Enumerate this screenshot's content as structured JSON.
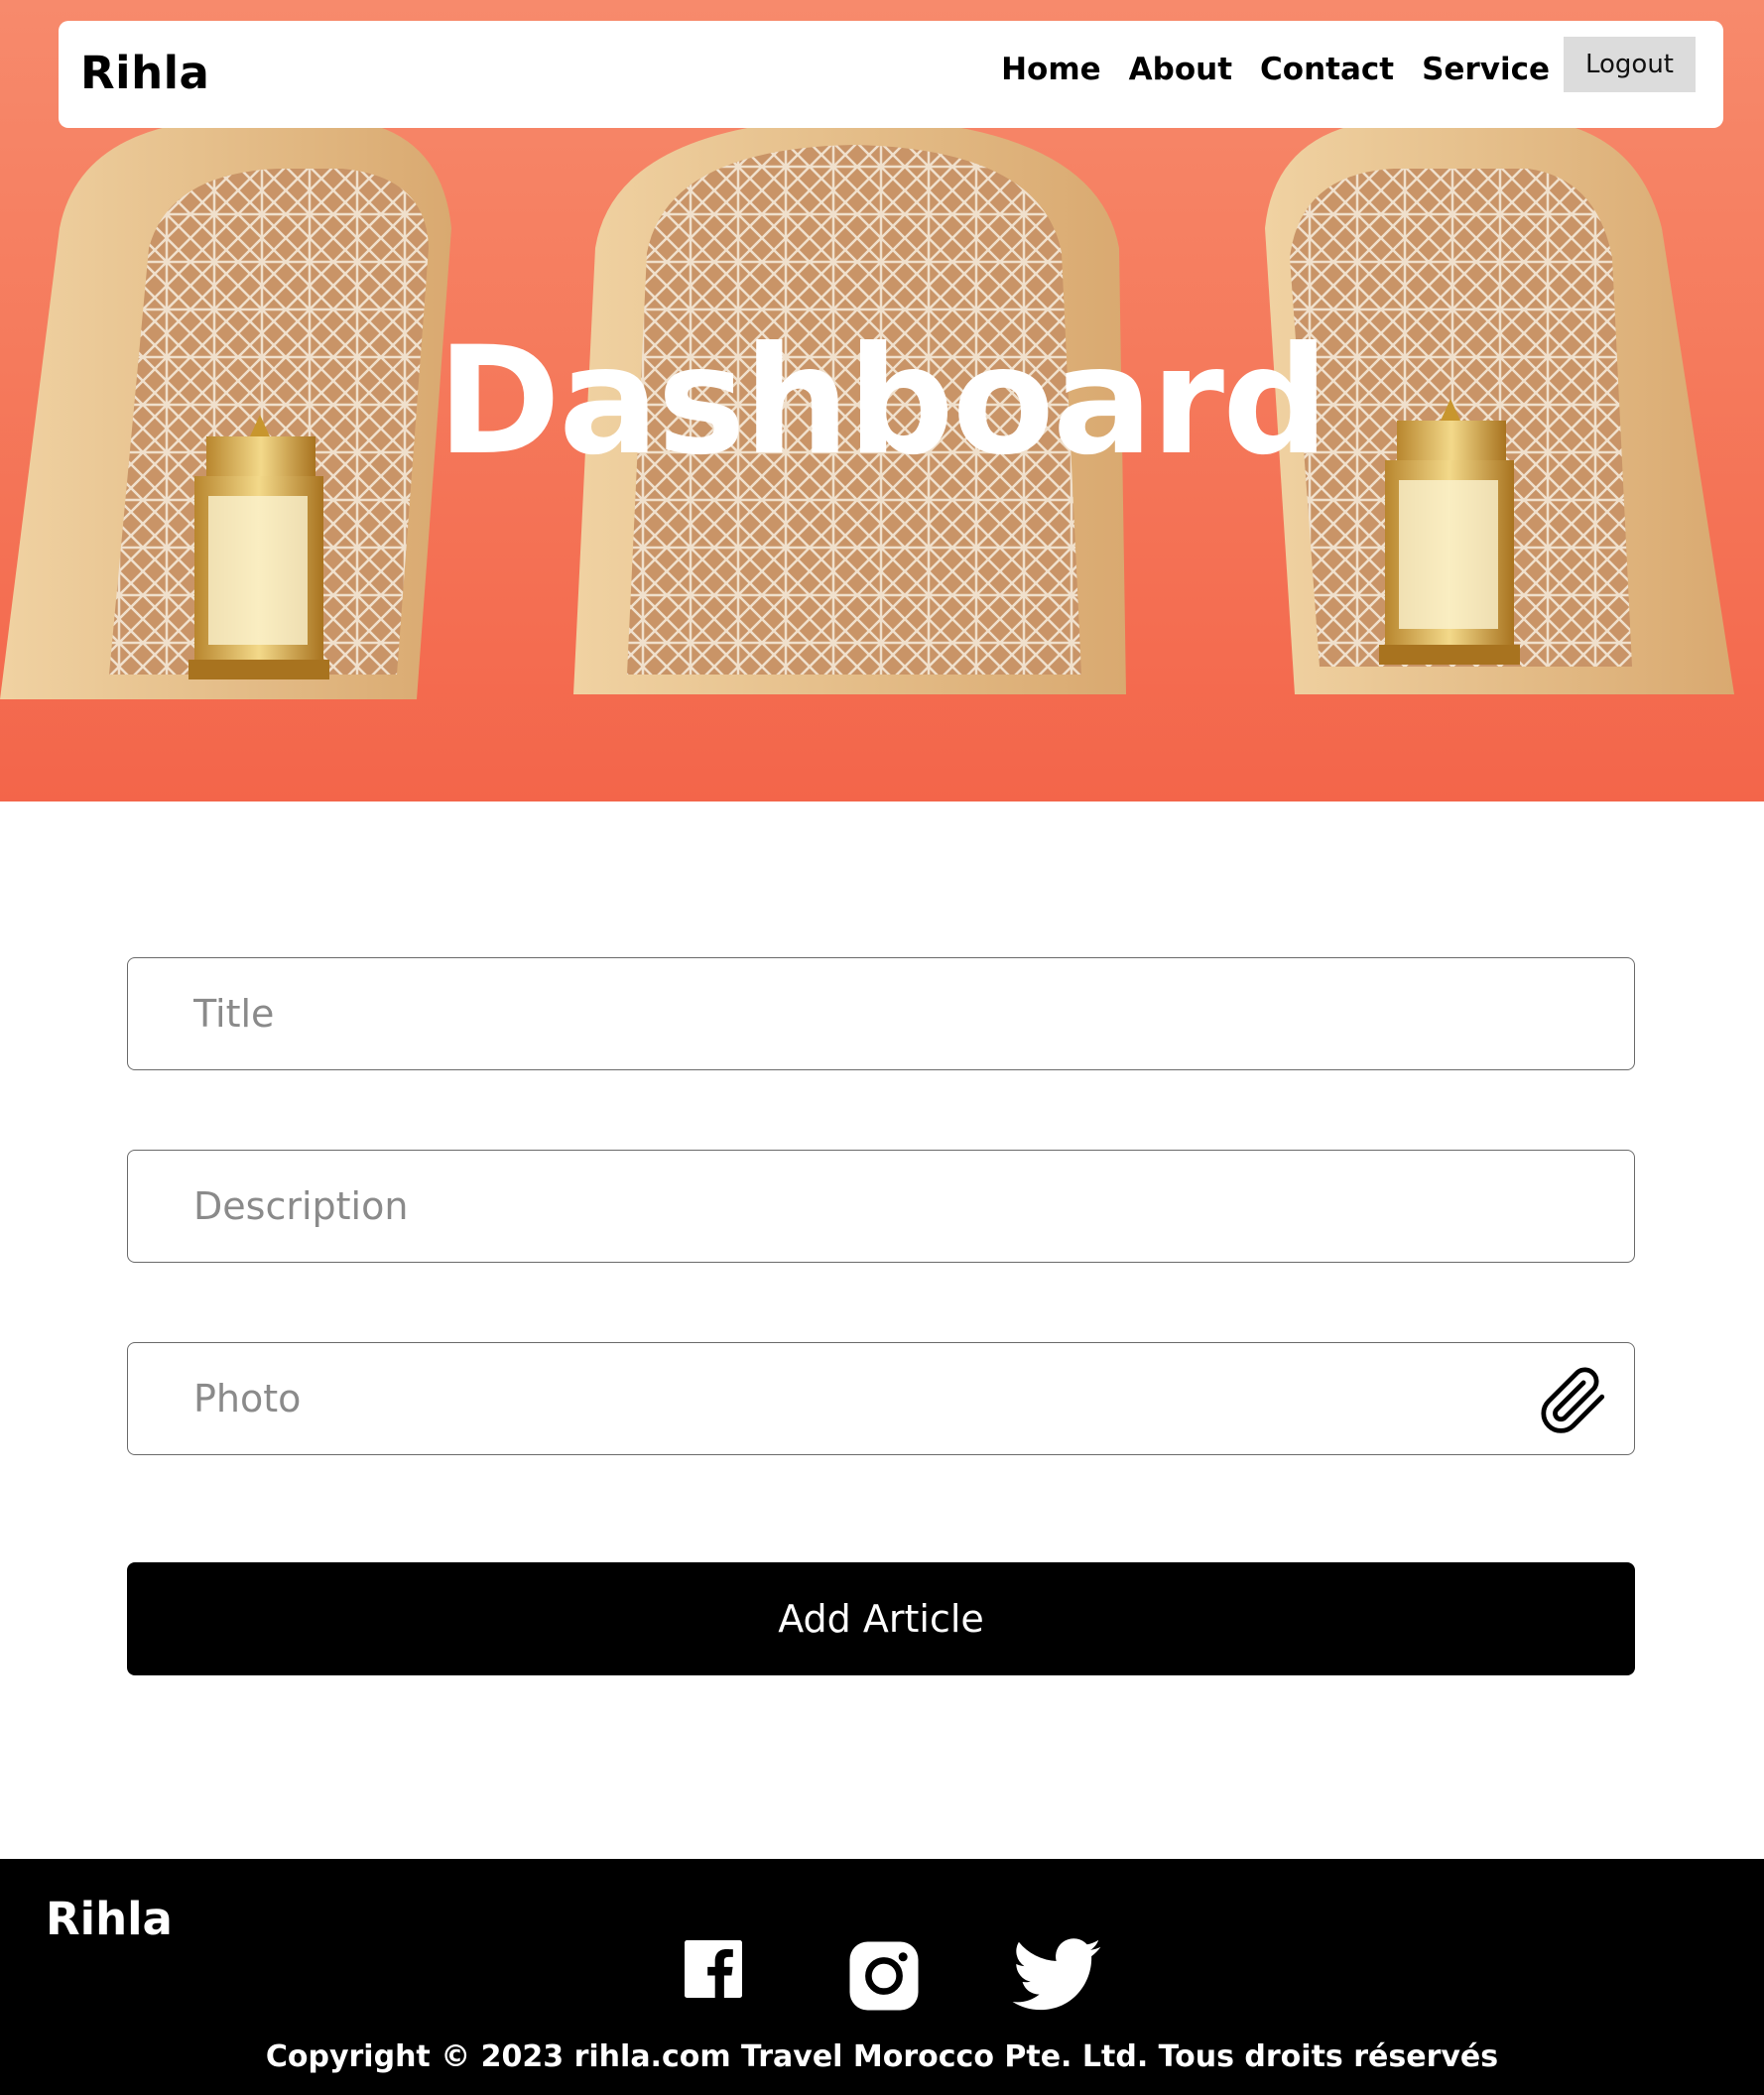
{
  "brand": "Rihla",
  "nav": {
    "items": [
      "Home",
      "About",
      "Contact",
      "Service"
    ],
    "logout": "Logout"
  },
  "hero": {
    "title": "Dashboard"
  },
  "form": {
    "title_placeholder": "Title",
    "description_placeholder": "Description",
    "photo_placeholder": "Photo",
    "submit_label": "Add Article"
  },
  "footer": {
    "brand": "Rihla",
    "social": [
      "facebook-icon",
      "instagram-icon",
      "twitter-icon"
    ],
    "copyright": "Copyright © 2023 rihla.com Travel Morocco Pte. Ltd. Tous droits réservés"
  },
  "colors": {
    "hero_background": "#f57a5c",
    "button": "#000000",
    "footer": "#000000",
    "logout_background": "#dcdcdc"
  }
}
